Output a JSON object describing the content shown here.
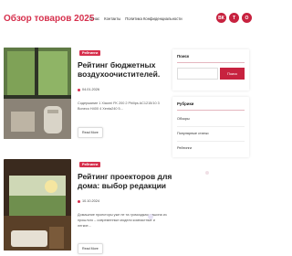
{
  "site": {
    "title": "Обзор товаров 2025"
  },
  "nav": {
    "items": [
      "О нас",
      "Контакты",
      "Политика Конфиденциальности"
    ]
  },
  "social": {
    "icons": [
      "vk-icon",
      "telegram-icon",
      "ok-icon"
    ],
    "glyphs": [
      "ВК",
      "Т",
      "О"
    ],
    "color": "#c7223f"
  },
  "posts": [
    {
      "badge": "Рейтинги",
      "title": "Рейтинг бюджетных воздухоочистителей.",
      "date": "04.01.2026",
      "excerpt": "Содержание 1 Xiaomi FK 200 2 Philips AC1215/10 3 Boneco H400 4 Xenta240 5...",
      "read_more": "Read More"
    },
    {
      "badge": "Рейтинги",
      "title": "Рейтинг проекторов для дома: выбор редакции",
      "date": "10.10.2024",
      "excerpt": "Домашние проекторы уже не та громоздкая машина из прошлого – современные модели компактные и легкие...",
      "read_more": "Read More"
    }
  ],
  "sidebar": {
    "search": {
      "title": "Поиск",
      "placeholder": "",
      "button": "Поиск"
    },
    "categories": {
      "title": "Рубрики",
      "items": [
        "Обзоры",
        "Популярные статьи",
        "Рейтинги"
      ]
    }
  },
  "colors": {
    "accent": "#d6304d",
    "accent_dark": "#c7223f"
  }
}
